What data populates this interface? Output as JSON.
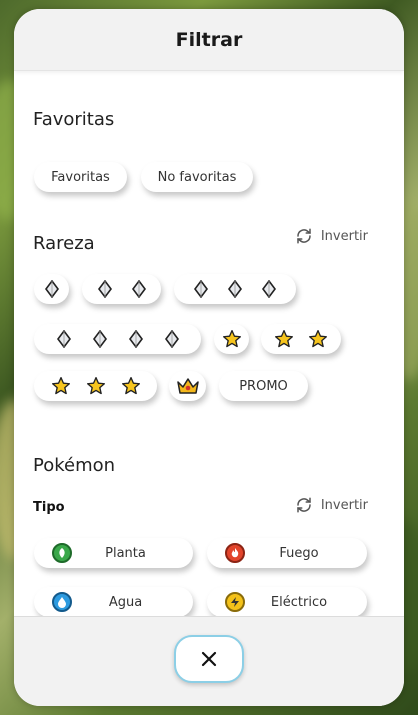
{
  "header": {
    "title": "Filtrar"
  },
  "favorites": {
    "title": "Favoritas",
    "options": [
      "Favoritas",
      "No favoritas"
    ]
  },
  "rarity": {
    "title": "Rareza",
    "invert_label": "Invertir",
    "options": [
      {
        "icon": "diamond",
        "count": 1
      },
      {
        "icon": "diamond",
        "count": 2
      },
      {
        "icon": "diamond",
        "count": 3
      },
      {
        "icon": "diamond",
        "count": 4
      },
      {
        "icon": "star",
        "count": 1
      },
      {
        "icon": "star",
        "count": 2
      },
      {
        "icon": "star",
        "count": 3
      },
      {
        "icon": "crown",
        "count": 1
      },
      {
        "icon": "text",
        "label": "PROMO"
      }
    ]
  },
  "pokemon": {
    "title": "Pokémon",
    "type_title": "Tipo",
    "invert_label": "Invertir",
    "types": [
      {
        "label": "Planta",
        "icon": "grass-icon",
        "color": "#3aa84a"
      },
      {
        "label": "Fuego",
        "icon": "fire-icon",
        "color": "#e2452c"
      },
      {
        "label": "Agua",
        "icon": "water-icon",
        "color": "#2d9be0"
      },
      {
        "label": "Eléctrico",
        "icon": "lightning-icon",
        "color": "#f4c21a"
      }
    ]
  },
  "footer": {
    "close_icon": "close-icon"
  }
}
